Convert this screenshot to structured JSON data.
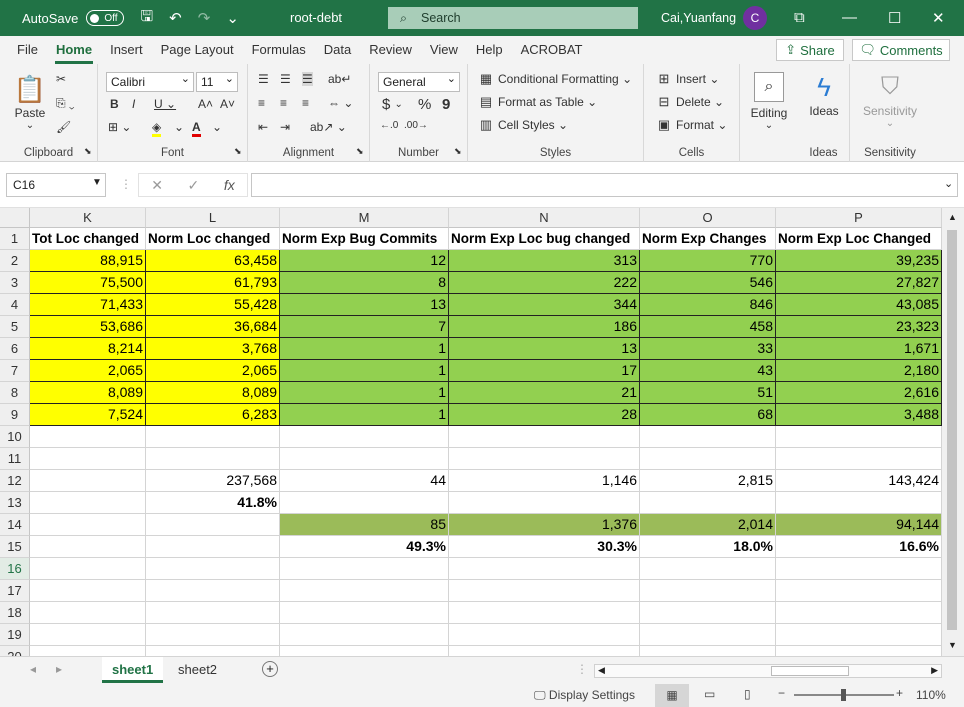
{
  "titlebar": {
    "autosave_label": "AutoSave",
    "autosave_state": "Off",
    "document_title": "root-debt",
    "search_placeholder": "Search",
    "user_name": "Cai,Yuanfang",
    "user_initial": "C"
  },
  "tabs": [
    "File",
    "Home",
    "Insert",
    "Page Layout",
    "Formulas",
    "Data",
    "Review",
    "View",
    "Help",
    "ACROBAT"
  ],
  "active_tab": "Home",
  "share_label": "Share",
  "comments_label": "Comments",
  "ribbon": {
    "clipboard": {
      "paste": "Paste",
      "label": "Clipboard"
    },
    "font": {
      "name": "Calibri",
      "size": "11",
      "label": "Font"
    },
    "alignment": {
      "label": "Alignment"
    },
    "number": {
      "format": "General",
      "currency": "$",
      "percent": "%",
      "comma": "9",
      "label": "Number"
    },
    "styles": {
      "conditional": "Conditional Formatting",
      "table": "Format as Table",
      "cell_styles": "Cell Styles",
      "label": "Styles"
    },
    "cells": {
      "insert": "Insert",
      "delete": "Delete",
      "format": "Format",
      "label": "Cells"
    },
    "editing": {
      "label": "Editing"
    },
    "ideas": {
      "button": "Ideas",
      "label": "Ideas"
    },
    "sensitivity": {
      "button": "Sensitivity",
      "label": "Sensitivity"
    }
  },
  "formula_bar": {
    "name_box": "C16",
    "fx": "fx",
    "cancel": "✕",
    "enter": "✓",
    "content": ""
  },
  "columns": [
    "K",
    "L",
    "M",
    "N",
    "O",
    "P"
  ],
  "rows": [
    "1",
    "2",
    "3",
    "4",
    "5",
    "6",
    "7",
    "8",
    "9",
    "10",
    "11",
    "12",
    "13",
    "14",
    "15",
    "16",
    "17",
    "18",
    "19",
    "20"
  ],
  "headers": [
    "Tot Loc changed",
    "Norm Loc changed",
    "Norm Exp Bug Commits",
    "Norm Exp Loc bug changed",
    "Norm Exp Changes",
    "Norm Exp Loc Changed"
  ],
  "data_rows": [
    [
      "88,915",
      "63,458",
      "12",
      "313",
      "770",
      "39,235"
    ],
    [
      "75,500",
      "61,793",
      "8",
      "222",
      "546",
      "27,827"
    ],
    [
      "71,433",
      "55,428",
      "13",
      "344",
      "846",
      "43,085"
    ],
    [
      "53,686",
      "36,684",
      "7",
      "186",
      "458",
      "23,323"
    ],
    [
      "8,214",
      "3,768",
      "1",
      "13",
      "33",
      "1,671"
    ],
    [
      "2,065",
      "2,065",
      "1",
      "17",
      "43",
      "2,180"
    ],
    [
      "8,089",
      "8,089",
      "1",
      "21",
      "51",
      "2,616"
    ],
    [
      "7,524",
      "6,283",
      "1",
      "28",
      "68",
      "3,488"
    ]
  ],
  "row12": [
    "",
    "237,568",
    "44",
    "1,146",
    "2,815",
    "143,424"
  ],
  "row13": [
    "",
    "41.8%",
    "",
    "",
    "",
    ""
  ],
  "row14": [
    "",
    "",
    "85",
    "1,376",
    "2,014",
    "94,144"
  ],
  "row15": [
    "",
    "",
    "49.3%",
    "30.3%",
    "18.0%",
    "16.6%"
  ],
  "sheets": [
    "sheet1",
    "sheet2"
  ],
  "active_sheet": "sheet1",
  "status": {
    "display_settings": "Display Settings",
    "zoom": "110%",
    "zoom_level": 1.1
  },
  "colors": {
    "brand": "#217346",
    "yellow": "#ffff00",
    "green": "#92d050",
    "olive": "#9bbb59"
  }
}
